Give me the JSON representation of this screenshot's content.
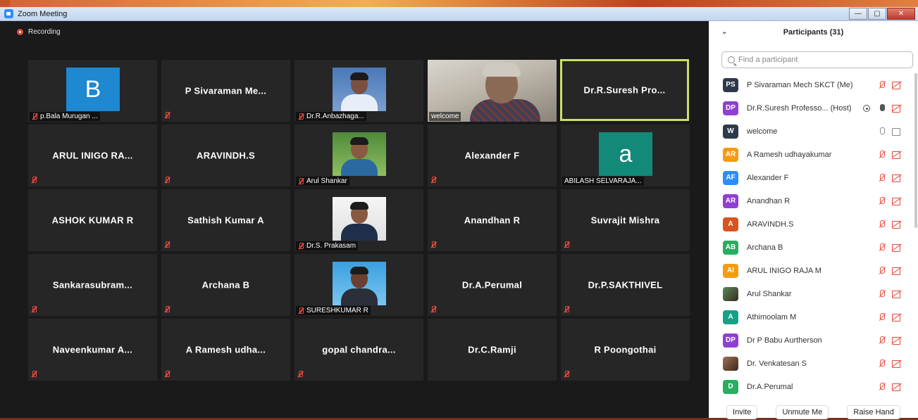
{
  "window": {
    "title": "Zoom Meeting",
    "buttons": [
      "—",
      "▢",
      "✕"
    ]
  },
  "recording": {
    "label": "Recording"
  },
  "tiles": [
    {
      "name": "",
      "label": "p.Bala Murugan ...",
      "avatar_letter": "B",
      "avatar_color": "#1e88d0",
      "muted": true
    },
    {
      "name": "P Sivaraman Me...",
      "label": "",
      "muted": true
    },
    {
      "name": "",
      "label": "Dr.R.Anbazhaga...",
      "photo": "man-blue-shirt",
      "muted": true
    },
    {
      "name": "",
      "label": "welcome",
      "video": "live",
      "muted": false
    },
    {
      "name": "Dr.R.Suresh Pro...",
      "label": "",
      "active": true,
      "muted": false
    },
    {
      "name": "ARUL INIGO RA...",
      "label": "",
      "muted": true
    },
    {
      "name": "ARAVINDH.S",
      "label": "",
      "muted": true
    },
    {
      "name": "",
      "label": "Arul Shankar",
      "photo": "man-green-bg",
      "muted": true
    },
    {
      "name": "Alexander F",
      "label": "",
      "muted": true
    },
    {
      "name": "",
      "label": "ABILASH SELVARAJA...",
      "avatar_letter": "a",
      "avatar_color": "#13897a",
      "muted": false
    },
    {
      "name": "ASHOK KUMAR R",
      "label": "",
      "muted": false
    },
    {
      "name": "Sathish Kumar A",
      "label": "",
      "muted": true
    },
    {
      "name": "",
      "label": "Dr.S. Prakasam",
      "photo": "man-white-bg",
      "muted": true
    },
    {
      "name": "Anandhan R",
      "label": "",
      "muted": true
    },
    {
      "name": "Suvrajit Mishra",
      "label": "",
      "muted": true
    },
    {
      "name": "Sankarasubram...",
      "label": "",
      "muted": true
    },
    {
      "name": "Archana B",
      "label": "",
      "muted": true
    },
    {
      "name": "",
      "label": "SURESHKUMAR R",
      "photo": "man-blue-bg",
      "muted": true
    },
    {
      "name": "Dr.A.Perumal",
      "label": "",
      "muted": true
    },
    {
      "name": "Dr.P.SAKTHIVEL",
      "label": "",
      "muted": true
    },
    {
      "name": "Naveenkumar A...",
      "label": "",
      "muted": true
    },
    {
      "name": "A Ramesh udha...",
      "label": "",
      "muted": true
    },
    {
      "name": "gopal chandra...",
      "label": "",
      "muted": true
    },
    {
      "name": "Dr.C.Ramji",
      "label": "",
      "muted": false
    },
    {
      "name": "R Poongothai",
      "label": "",
      "muted": true
    }
  ],
  "participants_panel": {
    "title": "Participants (31)",
    "search_placeholder": "Find a participant",
    "participants": [
      {
        "initials": "PS",
        "color": "#2d3a4a",
        "name": "P Sivaraman Mech SKCT (Me)",
        "mic": "muted",
        "cam": "off"
      },
      {
        "initials": "DP",
        "color": "#8f3fd1",
        "name": "Dr.R.Suresh Professo... (Host)",
        "host": true,
        "mic": "live",
        "cam": "off"
      },
      {
        "initials": "W",
        "color": "#2d3a4a",
        "name": "welcome",
        "mic": "on",
        "cam": "on"
      },
      {
        "initials": "AR",
        "color": "#f39c12",
        "name": "A Ramesh udhayakumar",
        "mic": "muted",
        "cam": "off"
      },
      {
        "initials": "AF",
        "color": "#2d8cff",
        "name": "Alexander F",
        "mic": "muted",
        "cam": "off"
      },
      {
        "initials": "AR",
        "color": "#8f3fd1",
        "name": "Anandhan R",
        "mic": "muted",
        "cam": "off"
      },
      {
        "initials": "A",
        "color": "#d9531e",
        "name": "ARAVINDH.S",
        "mic": "muted",
        "cam": "off"
      },
      {
        "initials": "AB",
        "color": "#27ae60",
        "name": "Archana B",
        "mic": "muted",
        "cam": "off"
      },
      {
        "initials": "AI",
        "color": "#f39c12",
        "name": "ARUL INIGO RAJA M",
        "mic": "muted",
        "cam": "off"
      },
      {
        "initials": "",
        "color": "#5a8b5a",
        "name": "Arul Shankar",
        "photo": true,
        "mic": "muted",
        "cam": "off"
      },
      {
        "initials": "A",
        "color": "#16a085",
        "name": "Athimoolam M",
        "mic": "muted",
        "cam": "off"
      },
      {
        "initials": "DP",
        "color": "#8f3fd1",
        "name": "Dr P Babu Aurtherson",
        "mic": "muted",
        "cam": "off"
      },
      {
        "initials": "",
        "color": "#a07050",
        "name": "Dr. Venkatesan S",
        "photo": true,
        "mic": "muted",
        "cam": "off"
      },
      {
        "initials": "D",
        "color": "#27ae60",
        "name": "Dr.A.Perumal",
        "mic": "muted",
        "cam": "off"
      }
    ],
    "footer": {
      "invite": "Invite",
      "unmute": "Unmute Me",
      "raise_hand": "Raise Hand"
    }
  }
}
